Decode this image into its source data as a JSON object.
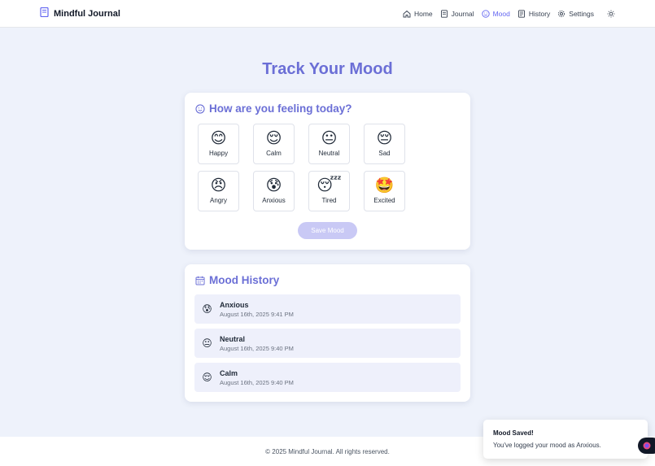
{
  "header": {
    "brand": "Mindful Journal",
    "nav": [
      {
        "label": "Home",
        "icon": "home-icon"
      },
      {
        "label": "Journal",
        "icon": "journal-icon"
      },
      {
        "label": "Mood",
        "icon": "smile-icon"
      },
      {
        "label": "History",
        "icon": "history-icon"
      },
      {
        "label": "Settings",
        "icon": "gear-icon"
      }
    ],
    "active": "Mood",
    "theme_icon": "sun-icon"
  },
  "page": {
    "title": "Track Your Mood"
  },
  "mood_card": {
    "heading": "How are you feeling today?",
    "moods": [
      {
        "label": "Happy",
        "emoji": "😊"
      },
      {
        "label": "Calm",
        "emoji": "😌"
      },
      {
        "label": "Neutral",
        "emoji": "😐"
      },
      {
        "label": "Sad",
        "emoji": "😔"
      },
      {
        "label": "Angry",
        "emoji": "😠"
      },
      {
        "label": "Anxious",
        "emoji": "😰"
      },
      {
        "label": "Tired",
        "emoji": "😴"
      },
      {
        "label": "Excited",
        "emoji": "🤩"
      }
    ],
    "save_label": "Save Mood"
  },
  "history_card": {
    "heading": "Mood History",
    "entries": [
      {
        "mood": "Anxious",
        "emoji": "😰",
        "time": "August 16th, 2025 9:41 PM"
      },
      {
        "mood": "Neutral",
        "emoji": "😐",
        "time": "August 16th, 2025 9:40 PM"
      },
      {
        "mood": "Calm",
        "emoji": "😌",
        "time": "August 16th, 2025 9:40 PM"
      }
    ]
  },
  "footer": {
    "text": "© 2025 Mindful Journal. All rights reserved."
  },
  "toast": {
    "title": "Mood Saved!",
    "message": "You've logged your mood as Anxious."
  },
  "colors": {
    "accent": "#6366f1",
    "heading": "#6b6fd6",
    "background": "#eef2fb",
    "save_disabled": "#c9c9f5"
  }
}
